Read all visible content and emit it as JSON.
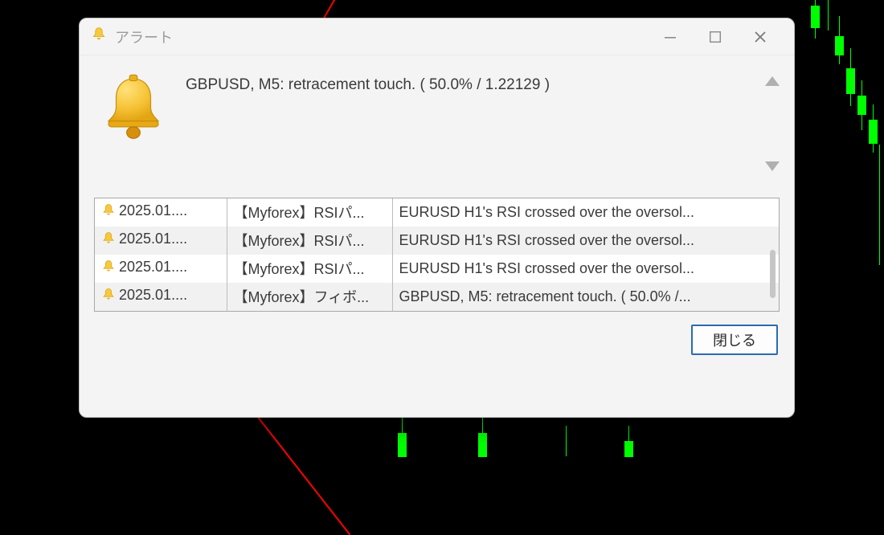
{
  "window": {
    "title": "アラート"
  },
  "summary": {
    "message": "GBPUSD, M5: retracement touch. ( 50.0% / 1.22129 )"
  },
  "alerts": [
    {
      "date": "2025.01....",
      "source": "【Myforex】RSIパ...",
      "message": "EURUSD H1's RSI crossed over the oversol..."
    },
    {
      "date": "2025.01....",
      "source": "【Myforex】RSIパ...",
      "message": "EURUSD H1's RSI crossed over the oversol..."
    },
    {
      "date": "2025.01....",
      "source": "【Myforex】RSIパ...",
      "message": "EURUSD H1's RSI crossed over the oversol..."
    },
    {
      "date": "2025.01....",
      "source": "【Myforex】フィボ...",
      "message": "GBPUSD, M5: retracement touch. ( 50.0% /..."
    }
  ],
  "footer": {
    "close_label": "閉じる"
  },
  "icons": {
    "bell": "bell-icon"
  }
}
